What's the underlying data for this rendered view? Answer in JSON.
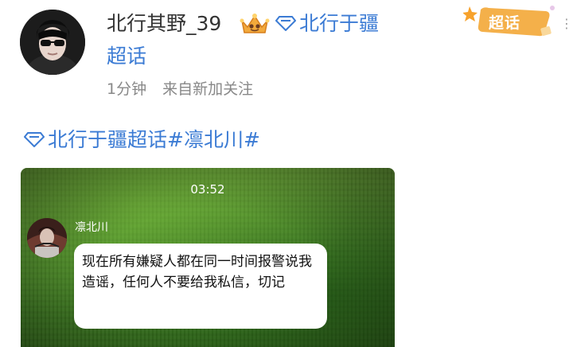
{
  "post": {
    "username": "北行其野_39",
    "topic_link_line1": "北行于疆",
    "topic_link_line2": "超话",
    "time_ago": "1分钟",
    "source": "来自新加关注",
    "badge_label": "超话",
    "more_icon": "ellipsis-icon",
    "text_topic": "北行于疆超话",
    "text_hashtag": "#凛北川#"
  },
  "media": {
    "timestamp": "03:52",
    "sender": "凛北川",
    "message": "现在所有嫌疑人都在同一时间报警说我造谣，任何人不要给我私信，切记"
  },
  "colors": {
    "link": "#3b7bd4",
    "meta": "#888888",
    "badge": "#f4b04a",
    "grass": "#4d8d2a"
  }
}
